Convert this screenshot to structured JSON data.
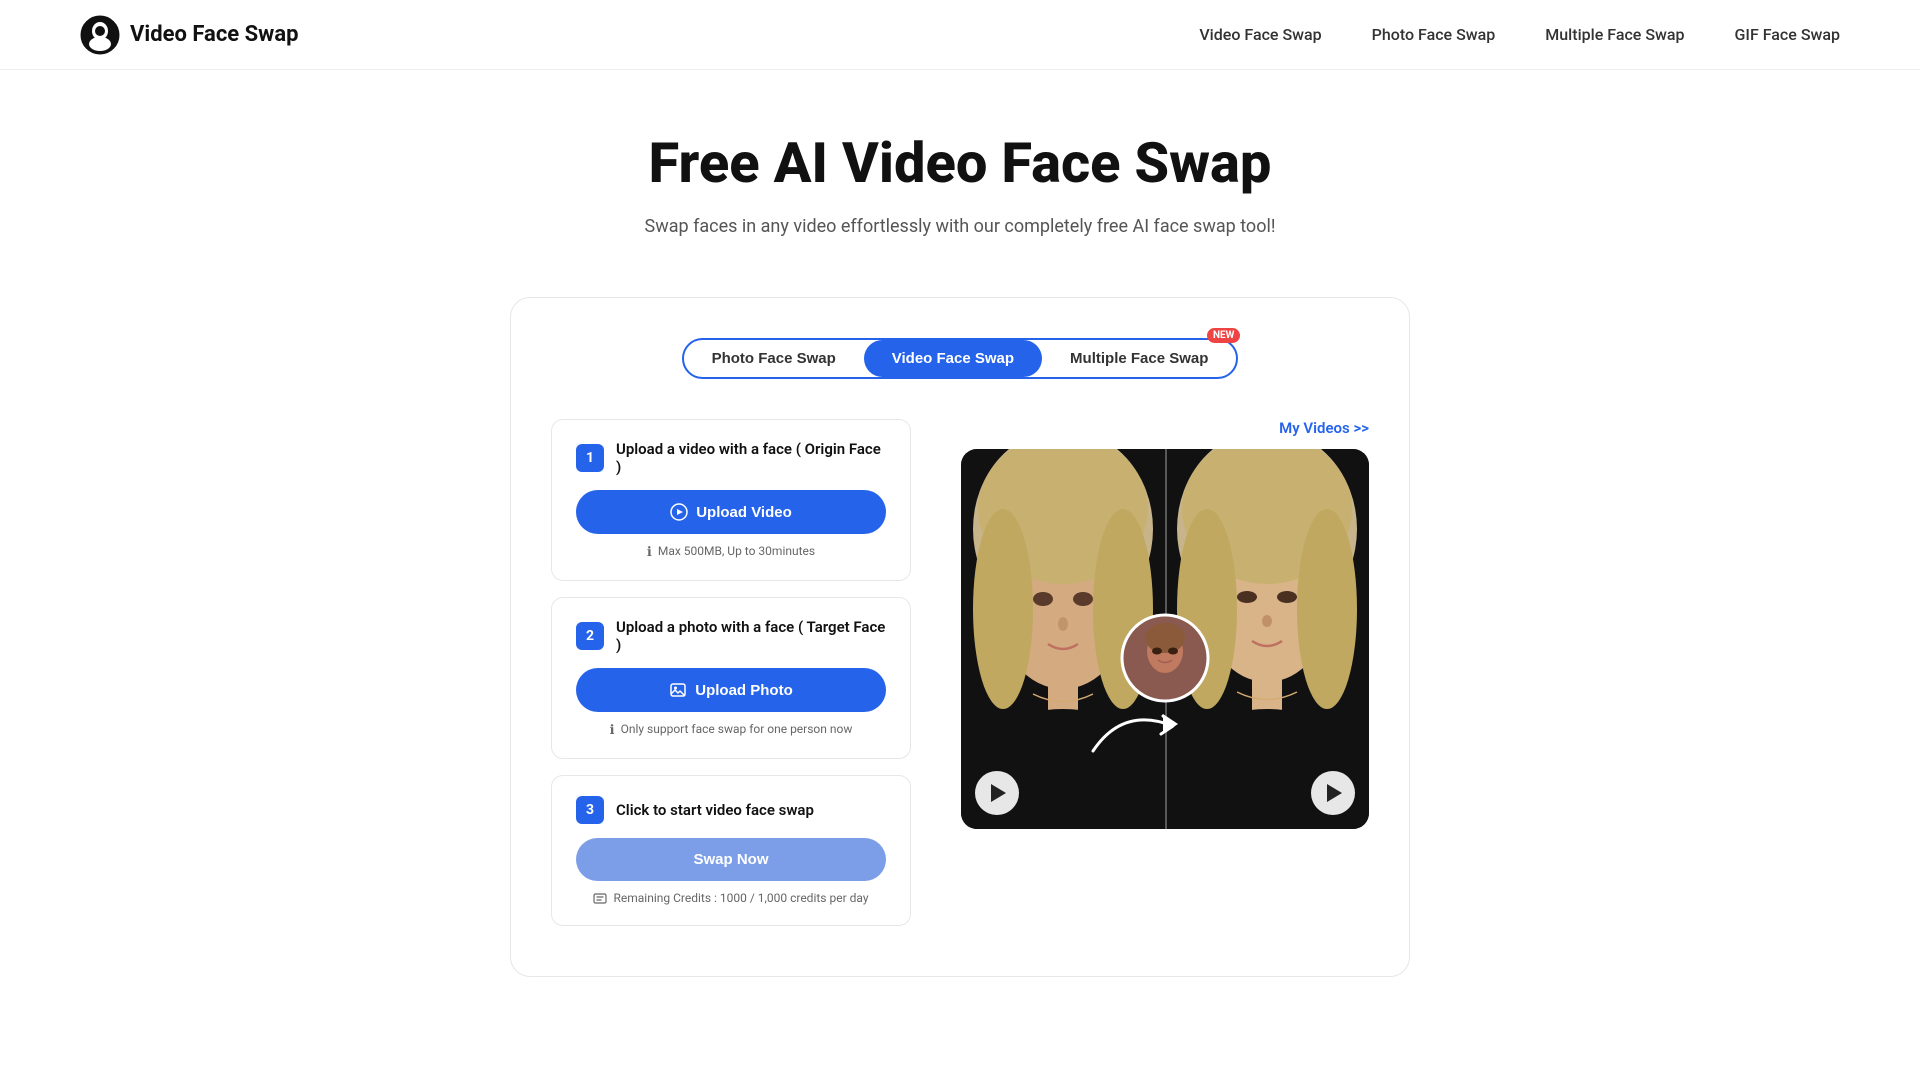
{
  "header": {
    "logo_text": "Video Face Swap",
    "nav": {
      "item1": "Video Face Swap",
      "item2": "Photo Face Swap",
      "item3": "Multiple Face Swap",
      "item4": "GIF Face Swap"
    }
  },
  "hero": {
    "title": "Free AI Video Face Swap",
    "subtitle": "Swap faces in any video effortlessly with our completely free AI face swap tool!"
  },
  "tabs": {
    "tab1": "Photo Face Swap",
    "tab2": "Video Face Swap",
    "tab3": "Multiple Face Swap",
    "new_badge": "NEW"
  },
  "my_videos_link": "My Videos >>",
  "steps": {
    "step1": {
      "number": "1",
      "title": "Upload a video with a face ( Origin Face )",
      "button": "Upload Video",
      "note": "Max 500MB, Up to 30minutes"
    },
    "step2": {
      "number": "2",
      "title": "Upload a photo with a face ( Target Face )",
      "button": "Upload Photo",
      "note": "Only support face swap for one person now"
    },
    "step3": {
      "number": "3",
      "title": "Click to start video face swap",
      "button": "Swap Now",
      "note": "Remaining Credits : 1000 / 1,000 credits per day"
    }
  }
}
